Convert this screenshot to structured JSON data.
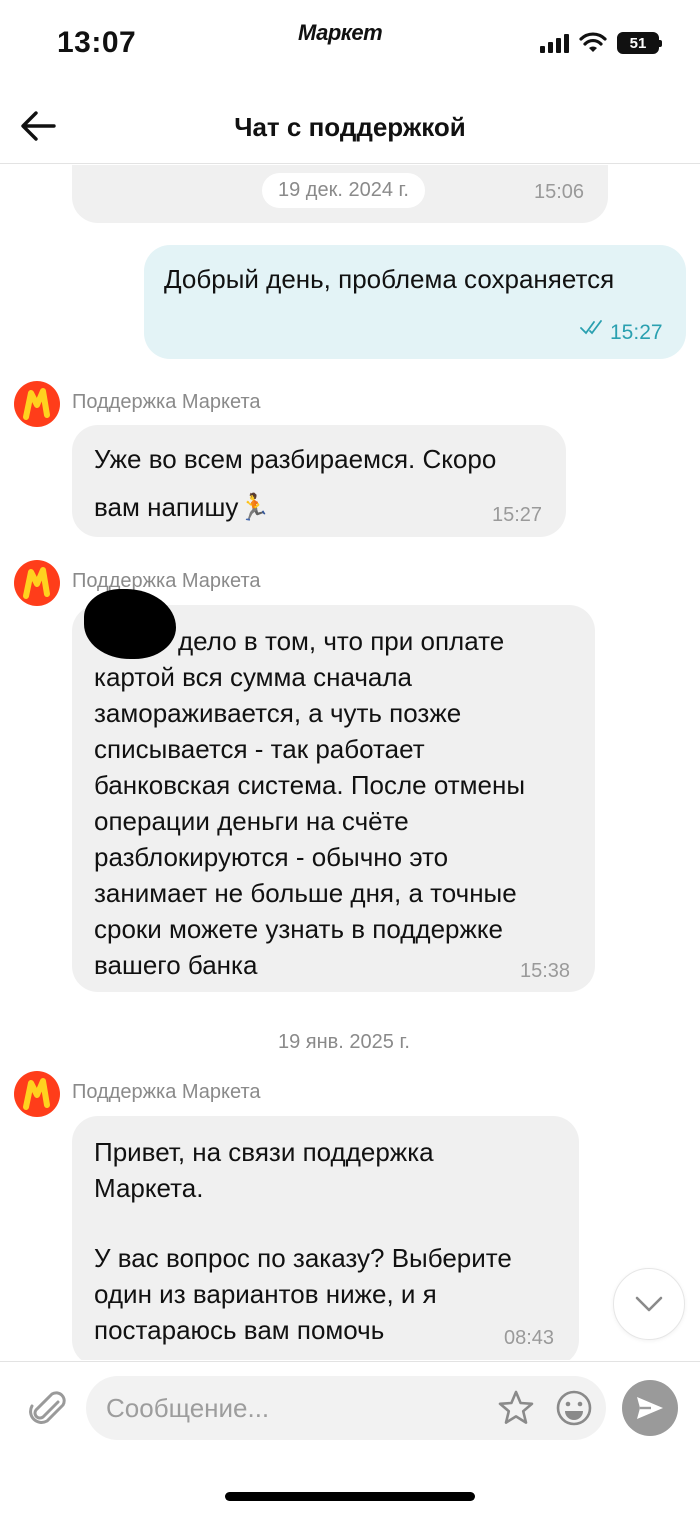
{
  "status_bar": {
    "time": "13:07",
    "brand": "Маркет",
    "battery": "51"
  },
  "header": {
    "title": "Чат с поддержкой"
  },
  "messages": [
    {
      "type": "date-in-bubble",
      "date": "19 дек. 2024 г.",
      "time": "15:06"
    },
    {
      "type": "outgoing",
      "text": "Добрый день, проблема сохраняется",
      "time": "15:27",
      "status": "read"
    },
    {
      "type": "incoming",
      "sender": "Поддержка Маркета",
      "lines": [
        "Уже во всем разбираемся. Скоро",
        "вам напишу🏃"
      ],
      "time": "15:27"
    },
    {
      "type": "incoming",
      "sender": "Поддержка Маркета",
      "lines": [
        "дело в том, что при оплате",
        "картой вся сумма сначала",
        "замораживается, а чуть позже",
        "списывается - так работает",
        "банковская система. После отмены",
        "операции деньги на счёте",
        "разблокируются - обычно это",
        "занимает не больше дня, а точные",
        "сроки можете узнать в поддержке",
        "вашего банка"
      ],
      "time": "15:38"
    },
    {
      "type": "date",
      "date": "19 янв. 2025 г."
    },
    {
      "type": "incoming",
      "sender": "Поддержка Маркета",
      "lines": [
        "Привет, на связи поддержка",
        "Маркета.",
        "",
        "У вас вопрос по заказу? Выберите",
        "один из вариантов ниже, и я",
        "постараюсь вам помочь"
      ],
      "time": "08:43"
    }
  ],
  "input": {
    "placeholder": "Сообщение..."
  },
  "colors": {
    "outgoing_bubble": "#e3f3f6",
    "incoming_bubble": "#f0f0f0",
    "read_check": "#2aa0b0",
    "avatar": "#ff3d1a",
    "avatar_m": "#ffd21f"
  },
  "icons": [
    "back-arrow-icon",
    "double-check-icon",
    "market-logo-icon",
    "chevron-down-icon",
    "paperclip-icon",
    "star-icon",
    "emoji-icon",
    "send-icon"
  ]
}
